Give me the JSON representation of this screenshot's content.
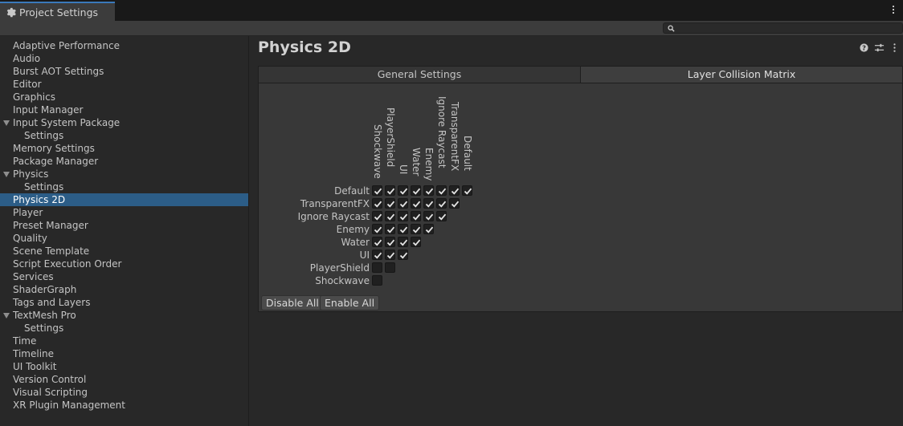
{
  "window": {
    "tab_title": "Project Settings"
  },
  "search": {
    "placeholder": ""
  },
  "sidebar": {
    "items": [
      {
        "label": "Adaptive Performance",
        "level": 0
      },
      {
        "label": "Audio",
        "level": 0
      },
      {
        "label": "Burst AOT Settings",
        "level": 0
      },
      {
        "label": "Editor",
        "level": 0
      },
      {
        "label": "Graphics",
        "level": 0
      },
      {
        "label": "Input Manager",
        "level": 0
      },
      {
        "label": "Input System Package",
        "level": 0,
        "expanded": true
      },
      {
        "label": "Settings",
        "level": 1
      },
      {
        "label": "Memory Settings",
        "level": 0
      },
      {
        "label": "Package Manager",
        "level": 0
      },
      {
        "label": "Physics",
        "level": 0,
        "expanded": true
      },
      {
        "label": "Settings",
        "level": 1
      },
      {
        "label": "Physics 2D",
        "level": 0,
        "selected": true
      },
      {
        "label": "Player",
        "level": 0
      },
      {
        "label": "Preset Manager",
        "level": 0
      },
      {
        "label": "Quality",
        "level": 0
      },
      {
        "label": "Scene Template",
        "level": 0
      },
      {
        "label": "Script Execution Order",
        "level": 0
      },
      {
        "label": "Services",
        "level": 0
      },
      {
        "label": "ShaderGraph",
        "level": 0
      },
      {
        "label": "Tags and Layers",
        "level": 0
      },
      {
        "label": "TextMesh Pro",
        "level": 0,
        "expanded": true
      },
      {
        "label": "Settings",
        "level": 1
      },
      {
        "label": "Time",
        "level": 0
      },
      {
        "label": "Timeline",
        "level": 0
      },
      {
        "label": "UI Toolkit",
        "level": 0
      },
      {
        "label": "Version Control",
        "level": 0
      },
      {
        "label": "Visual Scripting",
        "level": 0
      },
      {
        "label": "XR Plugin Management",
        "level": 0
      }
    ]
  },
  "main": {
    "title": "Physics 2D",
    "tabs": [
      {
        "label": "General Settings",
        "active": false
      },
      {
        "label": "Layer Collision Matrix",
        "active": true
      }
    ],
    "matrix": {
      "rows": [
        "Default",
        "TransparentFX",
        "Ignore Raycast",
        "Enemy",
        "Water",
        "UI",
        "PlayerShield",
        "Shockwave"
      ],
      "columns": [
        "Shockwave",
        "PlayerShield",
        "UI",
        "Water",
        "Enemy",
        "Ignore Raycast",
        "TransparentFX",
        "Default"
      ],
      "checked": [
        [
          true,
          true,
          true,
          true,
          true,
          true,
          true,
          true
        ],
        [
          true,
          true,
          true,
          true,
          true,
          true,
          true
        ],
        [
          true,
          true,
          true,
          true,
          true,
          true
        ],
        [
          true,
          true,
          true,
          true,
          true
        ],
        [
          true,
          true,
          true,
          true
        ],
        [
          true,
          true,
          true
        ],
        [
          false,
          false
        ],
        [
          false
        ]
      ]
    },
    "buttons": {
      "disable_all": "Disable All",
      "enable_all": "Enable All"
    }
  },
  "colors": {
    "selection": "#2c5d87",
    "accent": "#3a79bb",
    "background": "#282828",
    "panel": "#383838"
  }
}
